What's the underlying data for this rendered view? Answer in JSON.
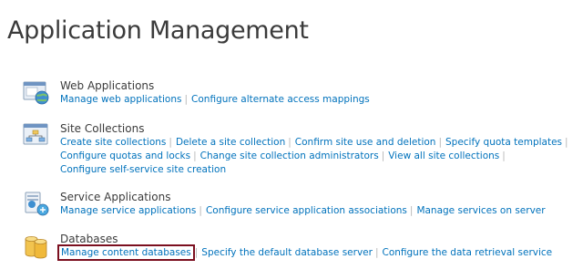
{
  "page": {
    "title": "Application Management"
  },
  "sections": [
    {
      "id": "web-applications",
      "title": "Web Applications",
      "icon": "web-application-icon",
      "lines": [
        [
          "Manage web applications",
          "Configure alternate access mappings"
        ]
      ]
    },
    {
      "id": "site-collections",
      "title": "Site Collections",
      "icon": "site-collection-icon",
      "lines": [
        [
          "Create site collections",
          "Delete a site collection",
          "Confirm site use and deletion",
          "Specify quota templates"
        ],
        [
          "Configure quotas and locks",
          "Change site collection administrators",
          "View all site collections"
        ],
        [
          "Configure self-service site creation"
        ]
      ],
      "trailing_separator_lines": [
        0,
        1
      ]
    },
    {
      "id": "service-applications",
      "title": "Service Applications",
      "icon": "service-application-icon",
      "lines": [
        [
          "Manage service applications",
          "Configure service application associations",
          "Manage services on server"
        ]
      ]
    },
    {
      "id": "databases",
      "title": "Databases",
      "icon": "database-icon",
      "lines": [
        [
          "Manage content databases",
          "Specify the default database server",
          "Configure the data retrieval service"
        ]
      ],
      "highlighted_link": "Manage content databases"
    }
  ],
  "colors": {
    "title_text": "#3b3b3b",
    "link": "#0072bc",
    "separator": "#b6b6b6",
    "highlight_border": "#7b0f1f"
  }
}
